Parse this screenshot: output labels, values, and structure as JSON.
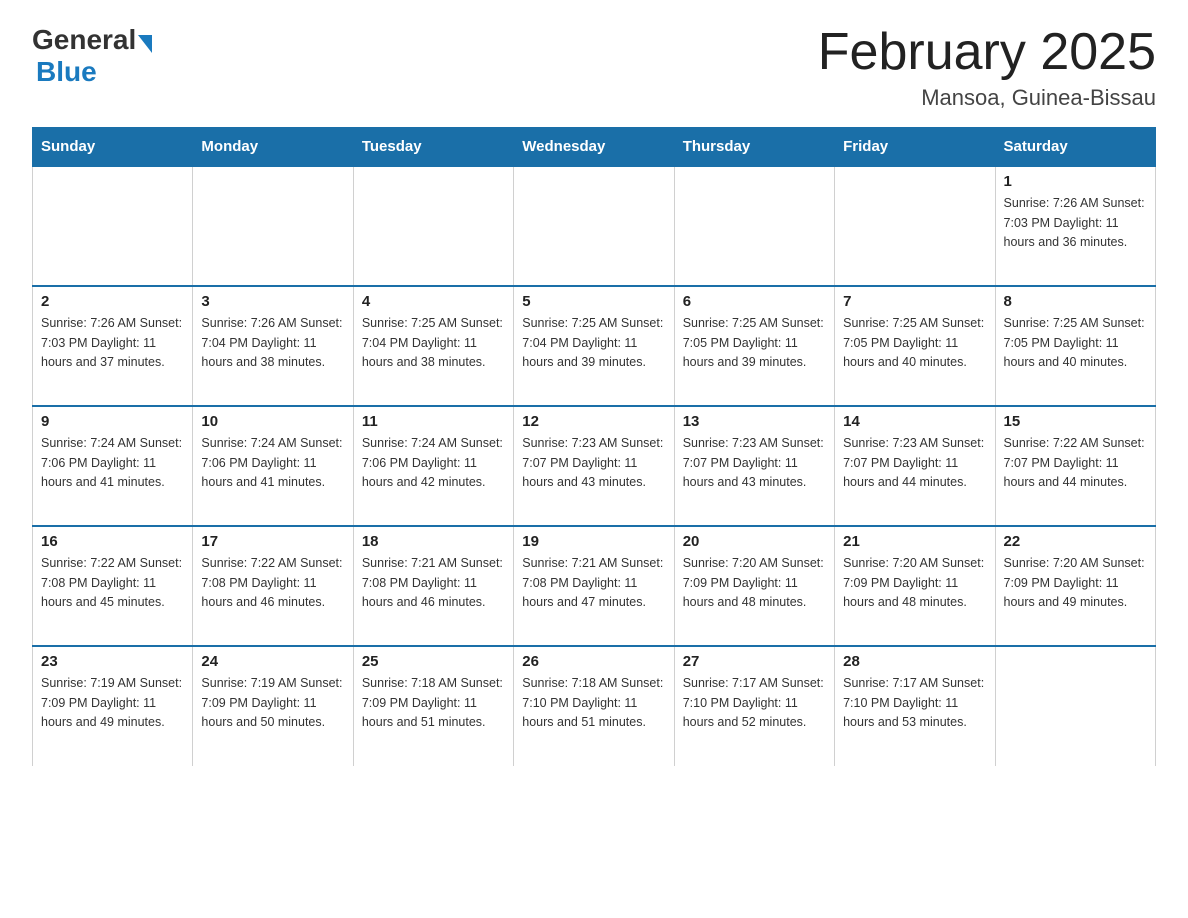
{
  "header": {
    "logo_general": "General",
    "logo_blue": "Blue",
    "title": "February 2025",
    "subtitle": "Mansoa, Guinea-Bissau"
  },
  "days_of_week": [
    "Sunday",
    "Monday",
    "Tuesday",
    "Wednesday",
    "Thursday",
    "Friday",
    "Saturday"
  ],
  "weeks": [
    {
      "cells": [
        {
          "day": "",
          "info": ""
        },
        {
          "day": "",
          "info": ""
        },
        {
          "day": "",
          "info": ""
        },
        {
          "day": "",
          "info": ""
        },
        {
          "day": "",
          "info": ""
        },
        {
          "day": "",
          "info": ""
        },
        {
          "day": "1",
          "info": "Sunrise: 7:26 AM\nSunset: 7:03 PM\nDaylight: 11 hours\nand 36 minutes."
        }
      ]
    },
    {
      "cells": [
        {
          "day": "2",
          "info": "Sunrise: 7:26 AM\nSunset: 7:03 PM\nDaylight: 11 hours\nand 37 minutes."
        },
        {
          "day": "3",
          "info": "Sunrise: 7:26 AM\nSunset: 7:04 PM\nDaylight: 11 hours\nand 38 minutes."
        },
        {
          "day": "4",
          "info": "Sunrise: 7:25 AM\nSunset: 7:04 PM\nDaylight: 11 hours\nand 38 minutes."
        },
        {
          "day": "5",
          "info": "Sunrise: 7:25 AM\nSunset: 7:04 PM\nDaylight: 11 hours\nand 39 minutes."
        },
        {
          "day": "6",
          "info": "Sunrise: 7:25 AM\nSunset: 7:05 PM\nDaylight: 11 hours\nand 39 minutes."
        },
        {
          "day": "7",
          "info": "Sunrise: 7:25 AM\nSunset: 7:05 PM\nDaylight: 11 hours\nand 40 minutes."
        },
        {
          "day": "8",
          "info": "Sunrise: 7:25 AM\nSunset: 7:05 PM\nDaylight: 11 hours\nand 40 minutes."
        }
      ]
    },
    {
      "cells": [
        {
          "day": "9",
          "info": "Sunrise: 7:24 AM\nSunset: 7:06 PM\nDaylight: 11 hours\nand 41 minutes."
        },
        {
          "day": "10",
          "info": "Sunrise: 7:24 AM\nSunset: 7:06 PM\nDaylight: 11 hours\nand 41 minutes."
        },
        {
          "day": "11",
          "info": "Sunrise: 7:24 AM\nSunset: 7:06 PM\nDaylight: 11 hours\nand 42 minutes."
        },
        {
          "day": "12",
          "info": "Sunrise: 7:23 AM\nSunset: 7:07 PM\nDaylight: 11 hours\nand 43 minutes."
        },
        {
          "day": "13",
          "info": "Sunrise: 7:23 AM\nSunset: 7:07 PM\nDaylight: 11 hours\nand 43 minutes."
        },
        {
          "day": "14",
          "info": "Sunrise: 7:23 AM\nSunset: 7:07 PM\nDaylight: 11 hours\nand 44 minutes."
        },
        {
          "day": "15",
          "info": "Sunrise: 7:22 AM\nSunset: 7:07 PM\nDaylight: 11 hours\nand 44 minutes."
        }
      ]
    },
    {
      "cells": [
        {
          "day": "16",
          "info": "Sunrise: 7:22 AM\nSunset: 7:08 PM\nDaylight: 11 hours\nand 45 minutes."
        },
        {
          "day": "17",
          "info": "Sunrise: 7:22 AM\nSunset: 7:08 PM\nDaylight: 11 hours\nand 46 minutes."
        },
        {
          "day": "18",
          "info": "Sunrise: 7:21 AM\nSunset: 7:08 PM\nDaylight: 11 hours\nand 46 minutes."
        },
        {
          "day": "19",
          "info": "Sunrise: 7:21 AM\nSunset: 7:08 PM\nDaylight: 11 hours\nand 47 minutes."
        },
        {
          "day": "20",
          "info": "Sunrise: 7:20 AM\nSunset: 7:09 PM\nDaylight: 11 hours\nand 48 minutes."
        },
        {
          "day": "21",
          "info": "Sunrise: 7:20 AM\nSunset: 7:09 PM\nDaylight: 11 hours\nand 48 minutes."
        },
        {
          "day": "22",
          "info": "Sunrise: 7:20 AM\nSunset: 7:09 PM\nDaylight: 11 hours\nand 49 minutes."
        }
      ]
    },
    {
      "cells": [
        {
          "day": "23",
          "info": "Sunrise: 7:19 AM\nSunset: 7:09 PM\nDaylight: 11 hours\nand 49 minutes."
        },
        {
          "day": "24",
          "info": "Sunrise: 7:19 AM\nSunset: 7:09 PM\nDaylight: 11 hours\nand 50 minutes."
        },
        {
          "day": "25",
          "info": "Sunrise: 7:18 AM\nSunset: 7:09 PM\nDaylight: 11 hours\nand 51 minutes."
        },
        {
          "day": "26",
          "info": "Sunrise: 7:18 AM\nSunset: 7:10 PM\nDaylight: 11 hours\nand 51 minutes."
        },
        {
          "day": "27",
          "info": "Sunrise: 7:17 AM\nSunset: 7:10 PM\nDaylight: 11 hours\nand 52 minutes."
        },
        {
          "day": "28",
          "info": "Sunrise: 7:17 AM\nSunset: 7:10 PM\nDaylight: 11 hours\nand 53 minutes."
        },
        {
          "day": "",
          "info": ""
        }
      ]
    }
  ]
}
